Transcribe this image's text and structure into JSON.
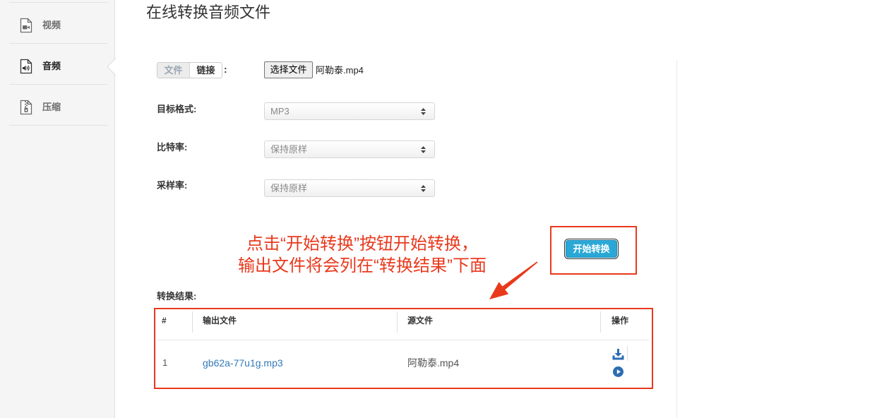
{
  "sidebar": {
    "items": [
      {
        "label": "视频",
        "icon": "video-file-icon",
        "active": false
      },
      {
        "label": "音频",
        "icon": "audio-file-icon",
        "active": true
      },
      {
        "label": "压缩",
        "icon": "zip-file-icon",
        "active": false
      }
    ]
  },
  "page": {
    "title": "在线转换音频文件"
  },
  "form": {
    "source_toggle": {
      "options": [
        "文件",
        "链接"
      ],
      "selected_index": 0,
      "suffix": ":"
    },
    "file_input": {
      "button_label": "选择文件",
      "file_name": "阿勒泰.mp4"
    },
    "target_format": {
      "label": "目标格式:",
      "value": "MP3",
      "icon": "updown-arrow-icon"
    },
    "bitrate": {
      "label": "比特率:",
      "value": "保持原样",
      "icon": "updown-arrow-icon"
    },
    "sample_rate": {
      "label": "采样率:",
      "value": "保持原样",
      "icon": "updown-arrow-icon"
    },
    "start_button_label": "开始转换"
  },
  "annotation": {
    "lines": [
      "点击“开始转换”按钮开始转换，",
      "输出文件将会列在“转换结果”下面"
    ],
    "arrow_icon": "red-arrow-icon"
  },
  "results": {
    "label": "转换结果:",
    "columns": [
      "#",
      "输出文件",
      "源文件",
      "操作"
    ],
    "rows": [
      {
        "index": "1",
        "output_file": "gb62a-77u1g.mp3",
        "source_file": "阿勒泰.mp4",
        "actions": [
          "download-icon",
          "play-circle-icon"
        ]
      }
    ]
  },
  "colors": {
    "annotation_red": "#e8391d",
    "button_blue": "#29a8d6",
    "link_blue": "#337ab7",
    "action_icon_blue": "#2c6db3",
    "sidebar_bg": "#f5f5f5"
  }
}
